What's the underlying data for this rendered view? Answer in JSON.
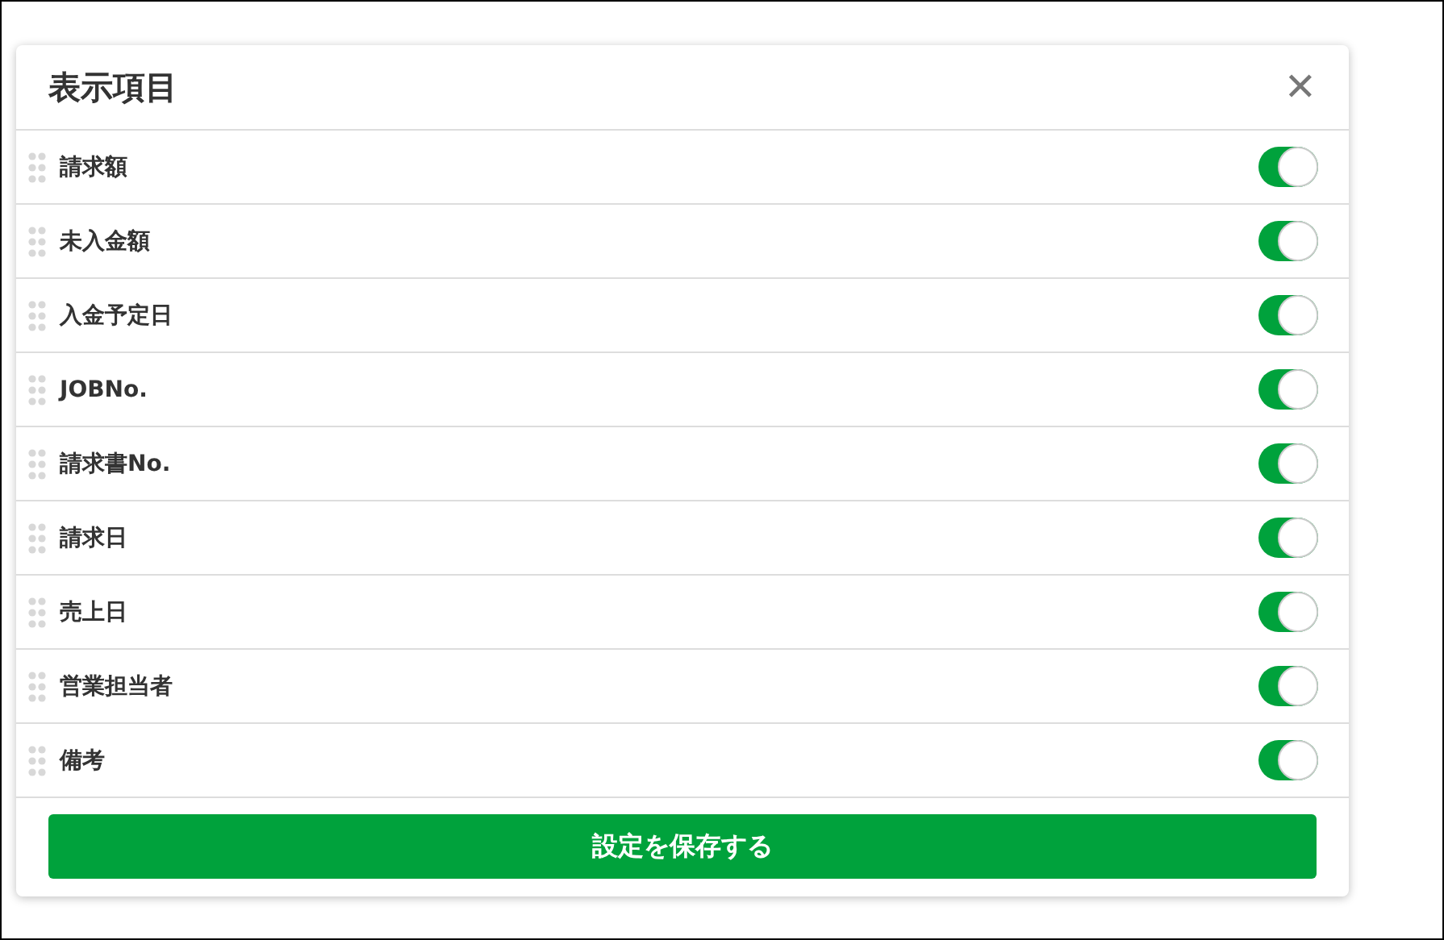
{
  "dialog": {
    "title": "表示項目",
    "close": "✕",
    "items": [
      {
        "label": "請求額",
        "on": true
      },
      {
        "label": "未入金額",
        "on": true
      },
      {
        "label": "入金予定日",
        "on": true
      },
      {
        "label": "JOBNo.",
        "on": true
      },
      {
        "label": "請求書No.",
        "on": true
      },
      {
        "label": "請求日",
        "on": true
      },
      {
        "label": "売上日",
        "on": true
      },
      {
        "label": "営業担当者",
        "on": true
      },
      {
        "label": "備考",
        "on": true
      }
    ],
    "save_button": "設定を保存する"
  }
}
